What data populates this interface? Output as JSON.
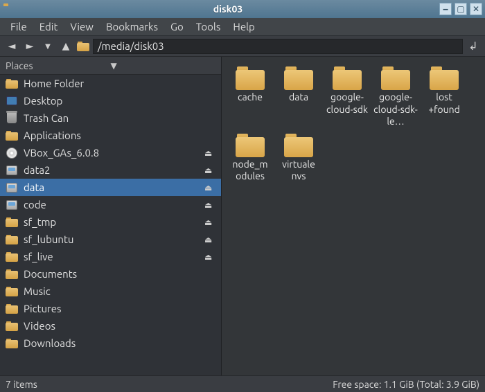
{
  "window": {
    "title": "disk03"
  },
  "menu": [
    "File",
    "Edit",
    "View",
    "Bookmarks",
    "Go",
    "Tools",
    "Help"
  ],
  "path": "/media/disk03",
  "sidebar": {
    "header": "Places",
    "items": [
      {
        "label": "Home Folder",
        "icon": "folder",
        "eject": false
      },
      {
        "label": "Desktop",
        "icon": "monitor",
        "eject": false
      },
      {
        "label": "Trash Can",
        "icon": "trash",
        "eject": false
      },
      {
        "label": "Applications",
        "icon": "folder",
        "eject": false
      },
      {
        "label": "VBox_GAs_6.0.8",
        "icon": "disc",
        "eject": true
      },
      {
        "label": "data2",
        "icon": "drive",
        "eject": true
      },
      {
        "label": "data",
        "icon": "drive",
        "eject": true,
        "selected": true
      },
      {
        "label": "code",
        "icon": "drive",
        "eject": true
      },
      {
        "label": "sf_tmp",
        "icon": "folder",
        "eject": true
      },
      {
        "label": "sf_lubuntu",
        "icon": "folder",
        "eject": true
      },
      {
        "label": "sf_live",
        "icon": "folder",
        "eject": true
      },
      {
        "label": "Documents",
        "icon": "folder",
        "eject": false
      },
      {
        "label": "Music",
        "icon": "folder",
        "eject": false
      },
      {
        "label": "Pictures",
        "icon": "folder",
        "eject": false
      },
      {
        "label": "Videos",
        "icon": "folder",
        "eject": false
      },
      {
        "label": "Downloads",
        "icon": "folder",
        "eject": false
      }
    ]
  },
  "files": [
    {
      "name": "cache"
    },
    {
      "name": "data"
    },
    {
      "name": "google-cloud-sdk"
    },
    {
      "name": "google-cloud-sdk-le…"
    },
    {
      "name": "lost +found"
    },
    {
      "name": "node_m odules"
    },
    {
      "name": "virtuale nvs"
    }
  ],
  "status": {
    "items": "7 items",
    "free": "Free space: 1.1 GiB (Total: 3.9 GiB)"
  }
}
